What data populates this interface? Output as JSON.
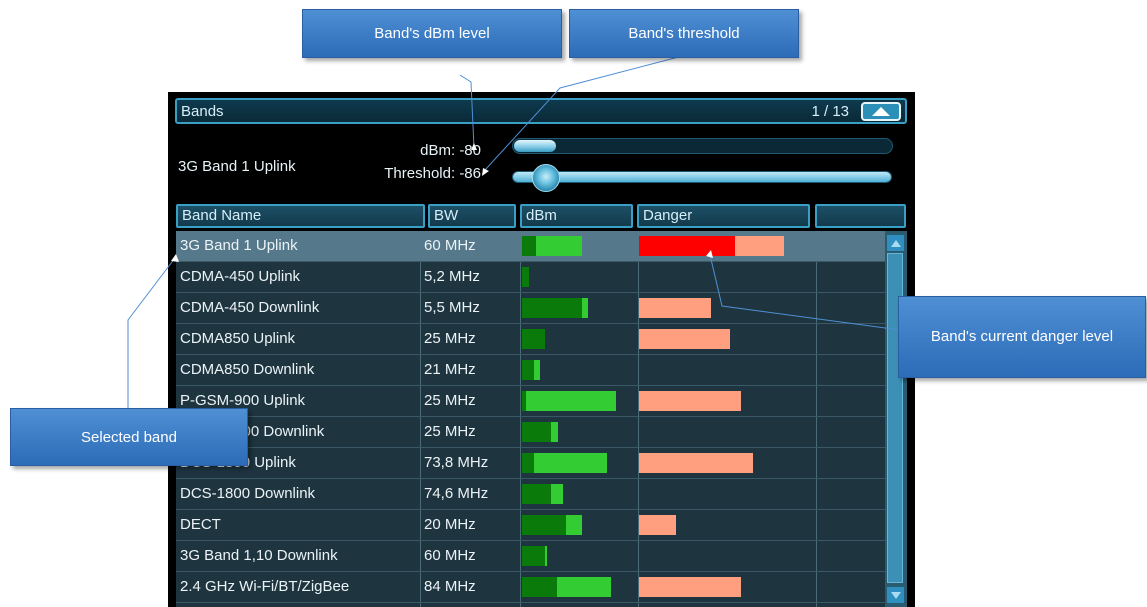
{
  "panel": {
    "title": "Bands",
    "page_indicator": "1 / 13",
    "up_button_icon": "triangle-up-icon"
  },
  "selected": {
    "name": "3G Band 1 Uplink",
    "dbm_label": "dBm:",
    "dbm_value": "-80",
    "threshold_label": "Threshold:",
    "threshold_value": "-86",
    "dbm_slider_fraction": 0.11,
    "threshold_slider_fraction": 0.09
  },
  "table": {
    "columns": [
      "Band Name",
      "BW",
      "dBm",
      "Danger",
      ""
    ],
    "rows": [
      {
        "name": "3G Band 1 Uplink",
        "bw": "60 MHz",
        "dbm_dark": 0.12,
        "dbm_total": 0.52,
        "danger_red": 0.55,
        "danger_total": 0.83,
        "selected": true
      },
      {
        "name": "CDMA-450 Uplink",
        "bw": "5,2 MHz",
        "dbm_dark": 0.06,
        "dbm_total": 0.06,
        "danger_red": 0,
        "danger_total": 0
      },
      {
        "name": "CDMA-450 Downlink",
        "bw": "5,5 MHz",
        "dbm_dark": 0.52,
        "dbm_total": 0.57,
        "danger_red": 0,
        "danger_total": 0.41
      },
      {
        "name": "CDMA850 Uplink",
        "bw": "25 MHz",
        "dbm_dark": 0.2,
        "dbm_total": 0.2,
        "danger_red": 0,
        "danger_total": 0.52
      },
      {
        "name": "CDMA850 Downlink",
        "bw": "21 MHz",
        "dbm_dark": 0.1,
        "dbm_total": 0.16,
        "danger_red": 0,
        "danger_total": 0
      },
      {
        "name": "P-GSM-900 Uplink",
        "bw": "25 MHz",
        "dbm_dark": 0.02,
        "dbm_total": 0.82,
        "danger_red": 0,
        "danger_total": 0.58
      },
      {
        "name": "P-GSM-900 Downlink",
        "bw": "25 MHz",
        "dbm_dark": 0.25,
        "dbm_total": 0.31,
        "danger_red": 0,
        "danger_total": 0
      },
      {
        "name": "DCS-1800 Uplink",
        "bw": "73,8 MHz",
        "dbm_dark": 0.1,
        "dbm_total": 0.74,
        "danger_red": 0,
        "danger_total": 0.65
      },
      {
        "name": "DCS-1800 Downlink",
        "bw": "74,6 MHz",
        "dbm_dark": 0.25,
        "dbm_total": 0.36,
        "danger_red": 0,
        "danger_total": 0
      },
      {
        "name": "DECT",
        "bw": "20 MHz",
        "dbm_dark": 0.38,
        "dbm_total": 0.52,
        "danger_red": 0,
        "danger_total": 0.21
      },
      {
        "name": "3G Band 1,10 Downlink",
        "bw": "60 MHz",
        "dbm_dark": 0.2,
        "dbm_total": 0.22,
        "danger_red": 0,
        "danger_total": 0
      },
      {
        "name": "2.4 GHz Wi-Fi/BT/ZigBee",
        "bw": "84 MHz",
        "dbm_dark": 0.3,
        "dbm_total": 0.77,
        "danger_red": 0,
        "danger_total": 0.58
      }
    ]
  },
  "colors": {
    "dbm_dark": "#0a7a0a",
    "dbm_light": "#33cc33",
    "danger_red": "#ff0000",
    "danger_salmon": "#ff9f7f"
  },
  "callouts": {
    "dbm_level": "Band's dBm level",
    "threshold": "Band's threshold",
    "danger_level": "Band's current danger level",
    "selected_band": "Selected band"
  }
}
